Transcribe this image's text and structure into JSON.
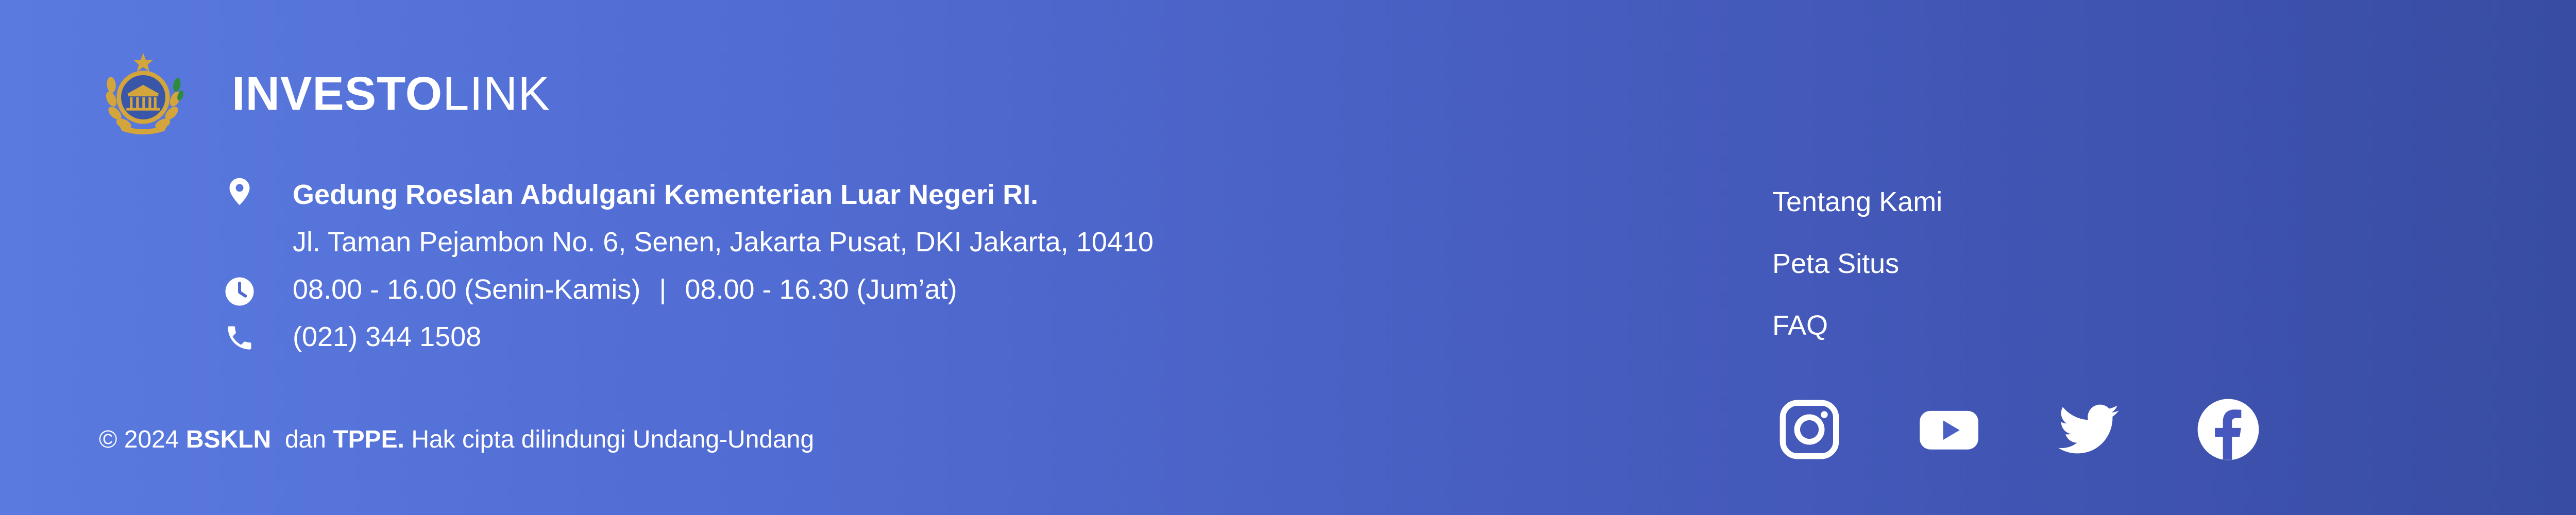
{
  "brand": {
    "name_bold": "INVESTO",
    "name_light": "LINK",
    "emblem_icon": "government-emblem-icon"
  },
  "contact": {
    "address_title": "Gedung Roeslan Abdulgani Kementerian Luar Negeri RI.",
    "address_line": "Jl. Taman Pejambon No. 6, Senen, Jakarta Pusat, DKI Jakarta, 10410",
    "hours_weekday": "08.00 - 16.00 (Senin-Kamis)",
    "hours_separator": "|",
    "hours_friday": "08.00 - 16.30 (Jum’at)",
    "phone": "(021) 344 1508",
    "icons": [
      "map-pin-icon",
      "clock-icon",
      "phone-icon"
    ]
  },
  "copyright": {
    "prefix": "© 2024",
    "org1": "BSKLN",
    "conj": "dan",
    "org2": "TPPE.",
    "suffix": "Hak cipta dilindungi Undang-Undang"
  },
  "links": [
    {
      "label": "Tentang Kami"
    },
    {
      "label": "Peta Situs"
    },
    {
      "label": "FAQ"
    }
  ],
  "social": [
    "instagram-icon",
    "youtube-icon",
    "twitter-icon",
    "facebook-icon"
  ],
  "colors": {
    "gradient_start": "#5a7ae0",
    "gradient_end": "#374ba1",
    "text": "#ffffff",
    "emblem_gold": "#d4a53a",
    "emblem_green": "#2e8b3e",
    "emblem_blue": "#3a56a8"
  }
}
